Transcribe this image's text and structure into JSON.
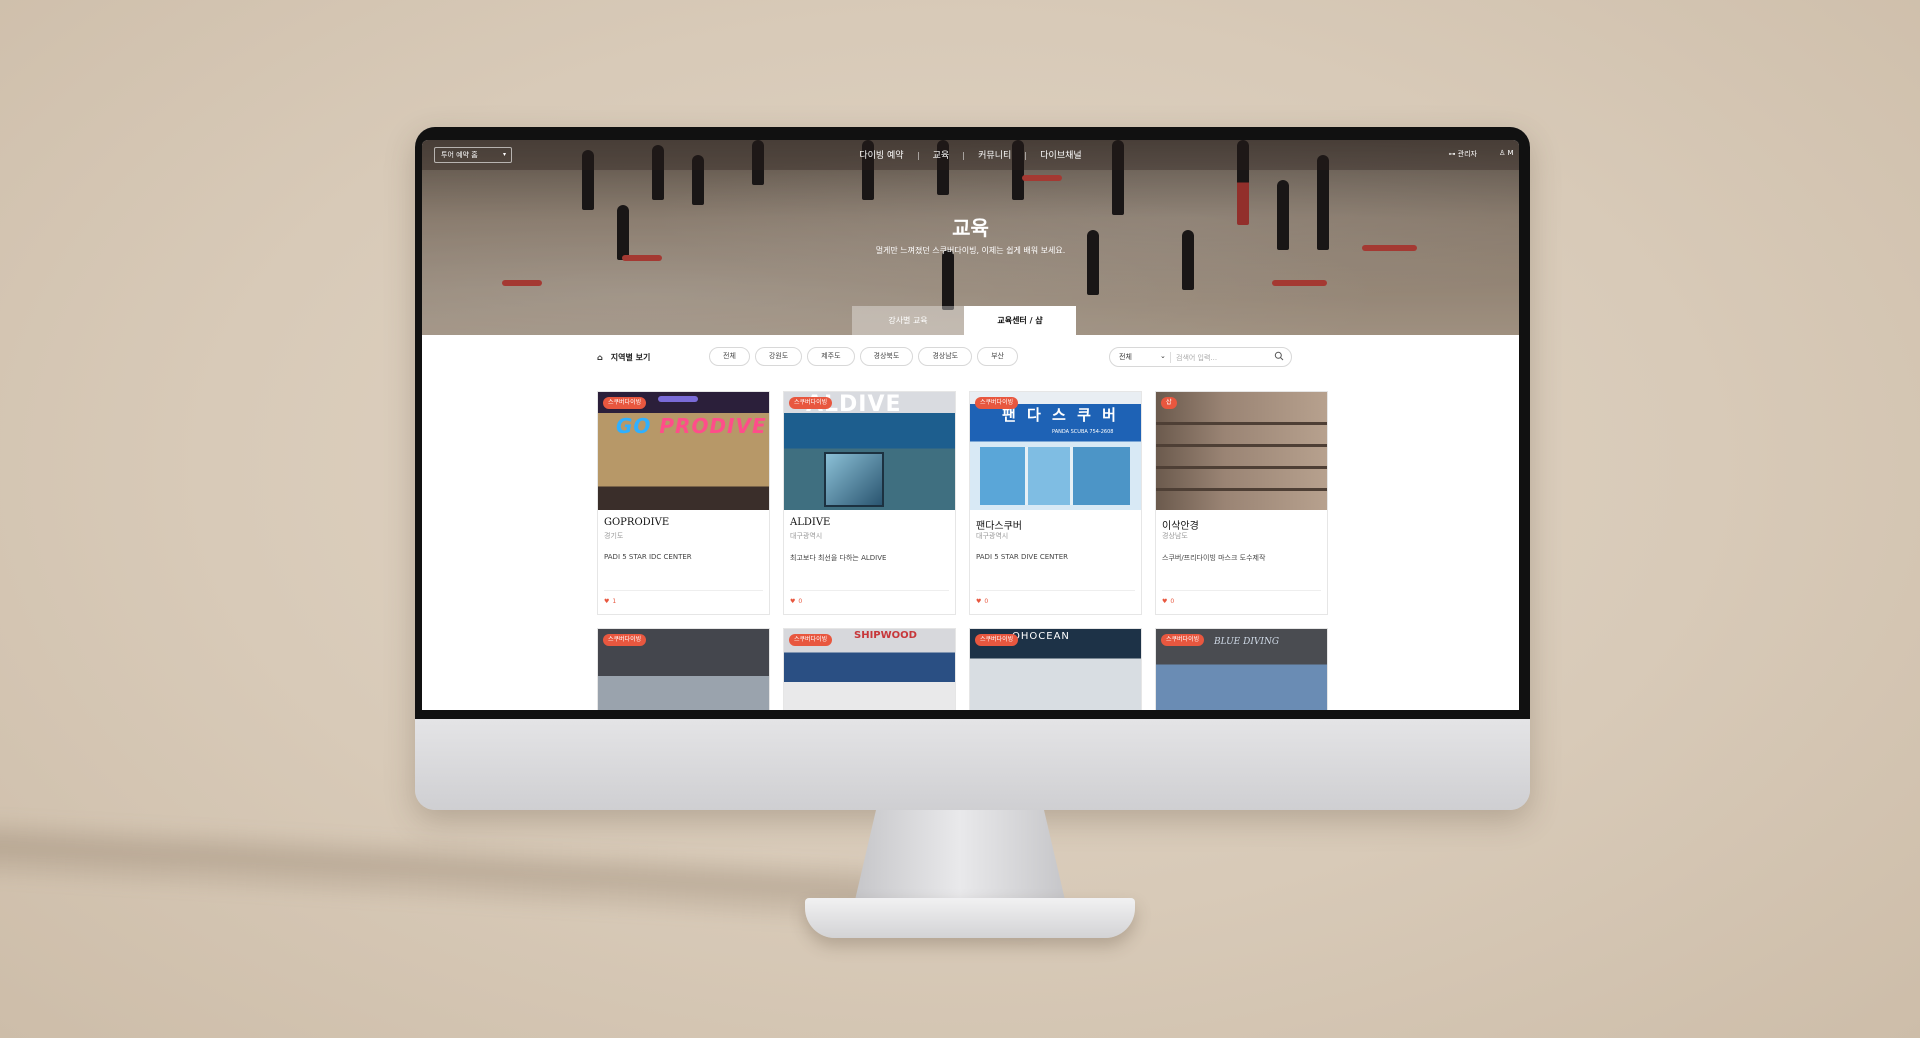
{
  "header": {
    "tour_select": "투어 예약 홈",
    "nav": [
      "다이빙 예약",
      "교육",
      "커뮤니티",
      "다이브채널"
    ],
    "admin_label": "관리자",
    "user_label": "M"
  },
  "hero": {
    "title": "교육",
    "subtitle": "멀게만 느껴졌던 스쿠버다이빙, 이제는 쉽게 배워 보세요.",
    "tabs": [
      "강사별 교육",
      "교육센터 / 샵"
    ]
  },
  "filter": {
    "region_label": "지역별 보기",
    "chips": [
      "전체",
      "강원도",
      "제주도",
      "경상북도",
      "경상남도",
      "부산"
    ],
    "search_select": "전체",
    "search_placeholder": "검색어 입력..."
  },
  "cards": [
    {
      "tag": "스쿠버다이빙",
      "name": "GOPRODIVE",
      "region": "경기도",
      "desc": "PADI 5 STAR IDC CENTER",
      "likes": "1"
    },
    {
      "tag": "스쿠버다이빙",
      "name": "ALDIVE",
      "region": "대구광역시",
      "desc": "최고보다 최선을 다하는 ALDIVE",
      "likes": "0"
    },
    {
      "tag": "스쿠버다이빙",
      "name": "팬다스쿠버",
      "region": "대구광역시",
      "desc": "PADI 5 STAR DIVE CENTER",
      "likes": "0"
    },
    {
      "tag": "샵",
      "name": "이삭안경",
      "region": "경상남도",
      "desc": "스쿠버/프리다이빙 마스크 도수제작",
      "likes": "0"
    },
    {
      "tag": "스쿠버다이빙"
    },
    {
      "tag": "스쿠버다이빙"
    },
    {
      "tag": "스쿠버다이빙"
    },
    {
      "tag": "스쿠버다이빙"
    }
  ],
  "thumb_text": {
    "goprodive_sign_a": "GO",
    "goprodive_sign_b": "PRODIVE",
    "aldive_sign": "ALDIVE",
    "panda_sign": "팬 다 스 쿠 버",
    "panda_sub": "PANDA SCUBA 754-2608",
    "shipwood_sign": "SHIPWOOD",
    "ohocean_sign": "OHOCEAN",
    "bluediving_sign": "BLUE DIVING"
  },
  "colors": {
    "accent": "#e8573f",
    "background": "#d8cab8"
  }
}
